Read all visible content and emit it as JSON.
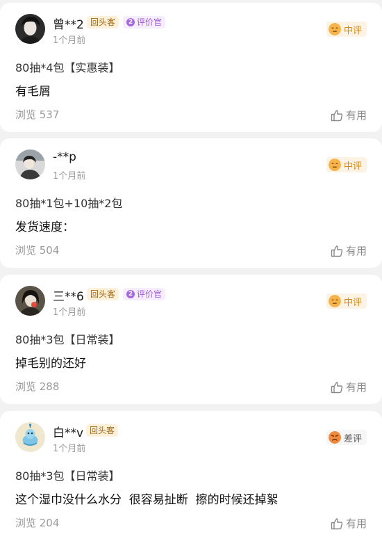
{
  "reviews": [
    {
      "username": "曾**2",
      "badges": {
        "returning": "回头客",
        "reviewer_level": "2",
        "reviewer": "评价官"
      },
      "time": "1个月前",
      "rating": "中评",
      "spec": "80抽*4包【实惠装】",
      "content": "有毛屑",
      "views": "浏览 537",
      "helpful": "有用"
    },
    {
      "username": "-**p",
      "time": "1个月前",
      "rating": "中评",
      "spec": "80抽*1包+10抽*2包",
      "content": "发货速度：",
      "views": "浏览 504",
      "helpful": "有用"
    },
    {
      "username": "三**6",
      "badges": {
        "returning": "回头客",
        "reviewer_level": "2",
        "reviewer": "评价官"
      },
      "time": "1个月前",
      "rating": "中评",
      "spec": "80抽*3包【日常装】",
      "content": "掉毛别的还好",
      "views": "浏览 288",
      "helpful": "有用"
    },
    {
      "username": "白**v",
      "badges": {
        "returning": "回头客"
      },
      "time": "1个月前",
      "rating": "差评",
      "spec": "80抽*3包【日常装】",
      "content": "这个湿巾没什么水分  很容易扯断  擦的时候还掉絮",
      "views": "浏览 204",
      "helpful": "有用"
    }
  ],
  "colors": {
    "background": "#f2f2f2",
    "card": "#ffffff",
    "mid_rating": "#d08a1f",
    "bad_rating": "#555555",
    "returning_badge": "#a06a14",
    "reviewer_badge": "#9b59d0"
  }
}
